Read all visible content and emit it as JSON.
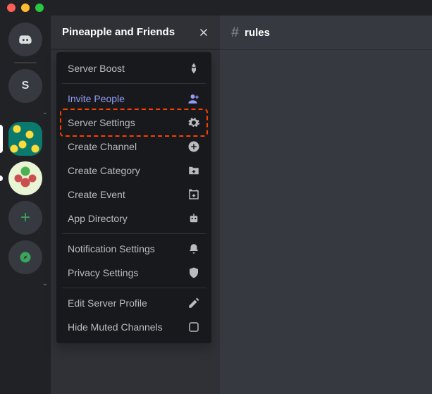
{
  "window": {
    "server_name": "Pineapple and Friends",
    "channel_name": "rules"
  },
  "guilds": {
    "home_letter": "",
    "letter": "S"
  },
  "menu": {
    "server_boost": "Server Boost",
    "invite_people": "Invite People",
    "server_settings": "Server Settings",
    "create_channel": "Create Channel",
    "create_category": "Create Category",
    "create_event": "Create Event",
    "app_directory": "App Directory",
    "notification_settings": "Notification Settings",
    "privacy_settings": "Privacy Settings",
    "edit_server_profile": "Edit Server Profile",
    "hide_muted_channels": "Hide Muted Channels"
  },
  "highlighted_item": "server_settings"
}
